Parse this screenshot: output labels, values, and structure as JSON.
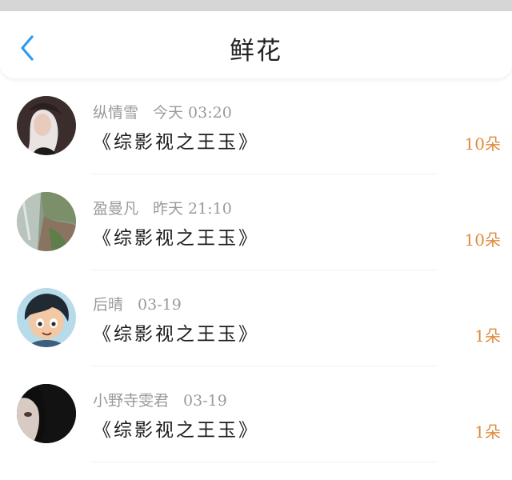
{
  "header": {
    "title": "鲜花",
    "back_icon": "chevron-left-icon",
    "accent_color": "#2f9bf0"
  },
  "colors": {
    "count": "#e08a3c",
    "meta": "#9a9a9a"
  },
  "items": [
    {
      "name": "纵情雪",
      "time": "今天 03:20",
      "work": "《综影视之王玉》",
      "count": "10朵"
    },
    {
      "name": "盈曼凡",
      "time": "昨天 21:10",
      "work": "《综影视之王玉》",
      "count": "10朵"
    },
    {
      "name": "后晴",
      "time": "03-19",
      "work": "《综影视之王玉》",
      "count": "1朵"
    },
    {
      "name": "小野寺雯君",
      "time": "03-19",
      "work": "《综影视之王玉》",
      "count": "1朵"
    }
  ]
}
